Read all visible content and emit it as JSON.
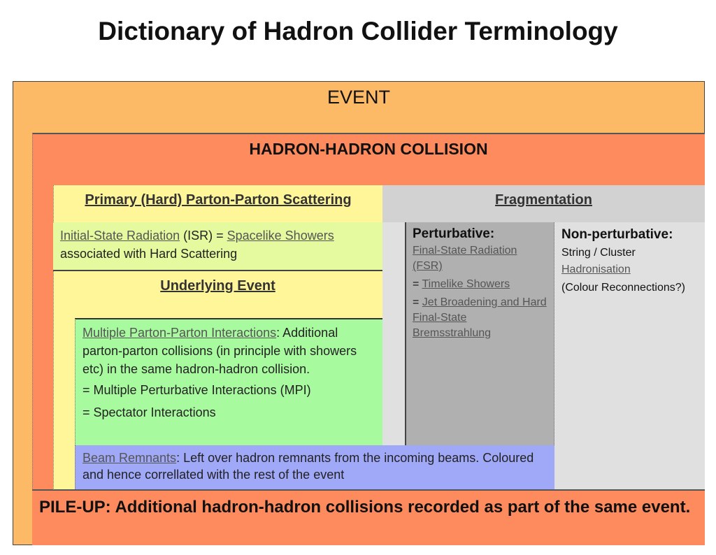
{
  "title": "Dictionary of Hadron Collider Terminology",
  "event": {
    "label": "EVENT"
  },
  "hadron": {
    "label": "HADRON-HADRON COLLISION"
  },
  "primary": {
    "heading": "Primary (Hard) Parton-Parton Scattering",
    "isr_link": "Initial-State Radiation",
    "isr_mid": " (ISR) = ",
    "isr_link2": "Spacelike Showers",
    "isr_rest": "associated with Hard Scattering"
  },
  "underlying": {
    "heading": "Underlying Event",
    "mpi_link": "Multiple Parton-Parton Interactions",
    "mpi_text": ": Additional parton-parton collisions (in principle with showers etc) in the same hadron-hadron collision.",
    "mpi_eq1": "= Multiple Perturbative Interactions (MPI)",
    "mpi_eq2": "= Spectator Interactions"
  },
  "beam": {
    "link": "Beam Remnants",
    "text": ": Left over hadron remnants from the incoming beams. Coloured and hence correllated with the rest of the event"
  },
  "fragmentation": {
    "heading": "Fragmentation",
    "perturbative": {
      "heading": "Perturbative:",
      "fsr": "Final-State Radiation (FSR)",
      "eq": "= ",
      "timelike": "Timelike Showers",
      "jet": "Jet Broadening and Hard Final-State Bremsstrahlung"
    },
    "nonperturbative": {
      "heading": "Non-perturbative:",
      "string": "String / Cluster",
      "hadronisation": "Hadronisation",
      "colour": "(Colour Reconnections?)"
    }
  },
  "pileup": {
    "text": "PILE-UP: Additional hadron-hadron collisions recorded as part of the same event."
  },
  "colors": {
    "event": "#fcba66",
    "hadron": "#fd8b5d",
    "primary": "#fff69a",
    "isr": "#e5f99f",
    "mpi": "#a8fa9f",
    "beam": "#a0a8f8",
    "fragmentation": "#d2d2d2",
    "perturbative": "#b0b0b0"
  }
}
